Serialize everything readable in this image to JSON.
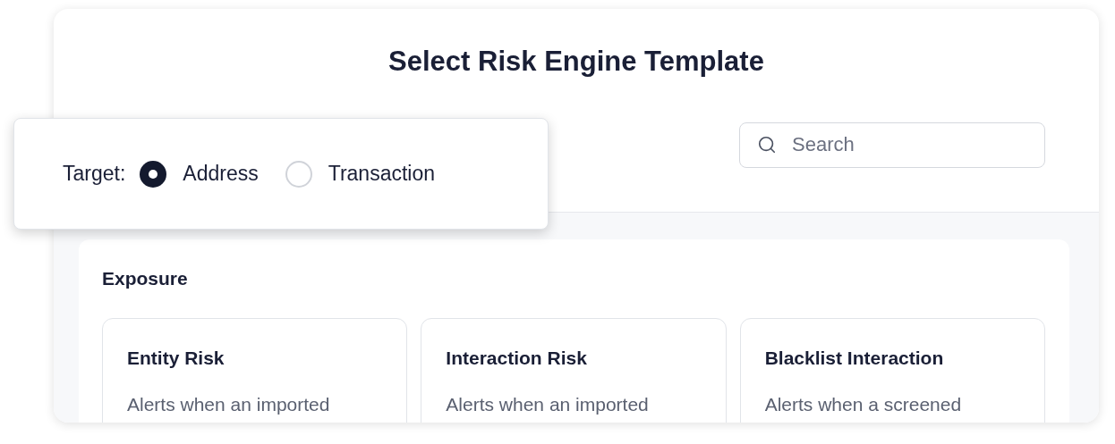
{
  "title": "Select Risk Engine Template",
  "target": {
    "label": "Target:",
    "options": [
      {
        "label": "Address",
        "selected": true
      },
      {
        "label": "Transaction",
        "selected": false
      }
    ]
  },
  "search": {
    "placeholder": "Search"
  },
  "section": {
    "title": "Exposure",
    "cards": [
      {
        "title": "Entity Risk",
        "description": "Alerts when an imported"
      },
      {
        "title": "Interaction Risk",
        "description": "Alerts when an imported"
      },
      {
        "title": "Blacklist Interaction",
        "description": "Alerts when a screened"
      }
    ]
  }
}
